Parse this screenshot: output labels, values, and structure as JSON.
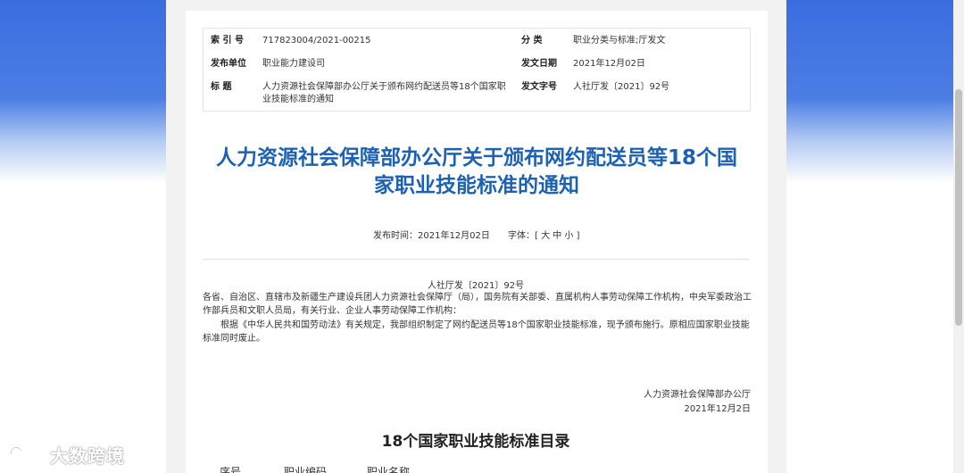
{
  "meta": {
    "index_label": "索 引 号",
    "index_value": "717823004/2021-00215",
    "category_label": "分 类",
    "category_value": "职业分类与标准;厅发文",
    "issuer_label": "发布单位",
    "issuer_value": "职业能力建设司",
    "date_label": "发文日期",
    "date_value": "2021年12月02日",
    "title_label": "标 题",
    "title_value": "人力资源社会保障部办公厅关于颁布网约配送员等18个国家职业技能标准的通知",
    "docno_label": "发文字号",
    "docno_value": "人社厅发〔2021〕92号"
  },
  "article": {
    "title_line1": "人力资源社会保障部办公厅关于颁布网约配送员等18个国",
    "title_line2": "家职业技能标准的通知",
    "publish_time": "发布时间：2021年12月02日",
    "font_size_label": "字体：[ 大 中 小 ]",
    "doc_number": "人社厅发〔2021〕92号",
    "recipients": "各省、自治区、直辖市及新疆生产建设兵团人力资源社会保障厅（局），国务院有关部委、直属机构人事劳动保障工作机构，中央军委政治工作部兵员和文职人员局，有关行业、企业人事劳动保障工作机构：",
    "paragraph": "根据《中华人民共和国劳动法》有关规定，我部组织制定了网约配送员等18个国家职业技能标准，现予颁布施行。原相应国家职业技能标准同时废止。",
    "signer": "人力资源社会保障部办公厅",
    "sign_date": "2021年12月2日",
    "section_title": "18个国家职业技能标准目录",
    "columns": [
      "序号",
      "职业编码",
      "职业名称"
    ]
  },
  "watermark": {
    "text": "大数跨境"
  },
  "colors": {
    "title": "#1c62b4",
    "banner": "#3a6ee0"
  }
}
